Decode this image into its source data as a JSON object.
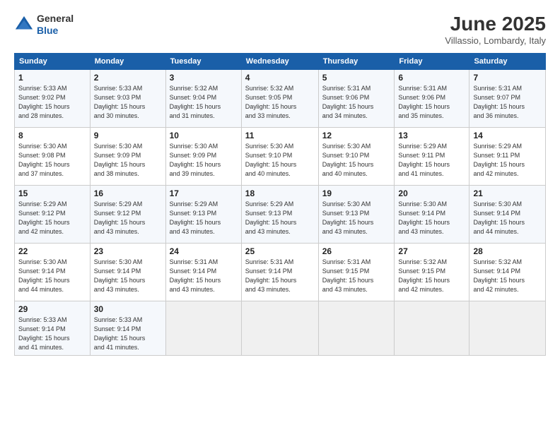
{
  "header": {
    "logo_general": "General",
    "logo_blue": "Blue",
    "title": "June 2025",
    "location": "Villassio, Lombardy, Italy"
  },
  "weekdays": [
    "Sunday",
    "Monday",
    "Tuesday",
    "Wednesday",
    "Thursday",
    "Friday",
    "Saturday"
  ],
  "weeks": [
    [
      {
        "day": "1",
        "info": "Sunrise: 5:33 AM\nSunset: 9:02 PM\nDaylight: 15 hours\nand 28 minutes."
      },
      {
        "day": "2",
        "info": "Sunrise: 5:33 AM\nSunset: 9:03 PM\nDaylight: 15 hours\nand 30 minutes."
      },
      {
        "day": "3",
        "info": "Sunrise: 5:32 AM\nSunset: 9:04 PM\nDaylight: 15 hours\nand 31 minutes."
      },
      {
        "day": "4",
        "info": "Sunrise: 5:32 AM\nSunset: 9:05 PM\nDaylight: 15 hours\nand 33 minutes."
      },
      {
        "day": "5",
        "info": "Sunrise: 5:31 AM\nSunset: 9:06 PM\nDaylight: 15 hours\nand 34 minutes."
      },
      {
        "day": "6",
        "info": "Sunrise: 5:31 AM\nSunset: 9:06 PM\nDaylight: 15 hours\nand 35 minutes."
      },
      {
        "day": "7",
        "info": "Sunrise: 5:31 AM\nSunset: 9:07 PM\nDaylight: 15 hours\nand 36 minutes."
      }
    ],
    [
      {
        "day": "8",
        "info": "Sunrise: 5:30 AM\nSunset: 9:08 PM\nDaylight: 15 hours\nand 37 minutes."
      },
      {
        "day": "9",
        "info": "Sunrise: 5:30 AM\nSunset: 9:09 PM\nDaylight: 15 hours\nand 38 minutes."
      },
      {
        "day": "10",
        "info": "Sunrise: 5:30 AM\nSunset: 9:09 PM\nDaylight: 15 hours\nand 39 minutes."
      },
      {
        "day": "11",
        "info": "Sunrise: 5:30 AM\nSunset: 9:10 PM\nDaylight: 15 hours\nand 40 minutes."
      },
      {
        "day": "12",
        "info": "Sunrise: 5:30 AM\nSunset: 9:10 PM\nDaylight: 15 hours\nand 40 minutes."
      },
      {
        "day": "13",
        "info": "Sunrise: 5:29 AM\nSunset: 9:11 PM\nDaylight: 15 hours\nand 41 minutes."
      },
      {
        "day": "14",
        "info": "Sunrise: 5:29 AM\nSunset: 9:11 PM\nDaylight: 15 hours\nand 42 minutes."
      }
    ],
    [
      {
        "day": "15",
        "info": "Sunrise: 5:29 AM\nSunset: 9:12 PM\nDaylight: 15 hours\nand 42 minutes."
      },
      {
        "day": "16",
        "info": "Sunrise: 5:29 AM\nSunset: 9:12 PM\nDaylight: 15 hours\nand 43 minutes."
      },
      {
        "day": "17",
        "info": "Sunrise: 5:29 AM\nSunset: 9:13 PM\nDaylight: 15 hours\nand 43 minutes."
      },
      {
        "day": "18",
        "info": "Sunrise: 5:29 AM\nSunset: 9:13 PM\nDaylight: 15 hours\nand 43 minutes."
      },
      {
        "day": "19",
        "info": "Sunrise: 5:30 AM\nSunset: 9:13 PM\nDaylight: 15 hours\nand 43 minutes."
      },
      {
        "day": "20",
        "info": "Sunrise: 5:30 AM\nSunset: 9:14 PM\nDaylight: 15 hours\nand 43 minutes."
      },
      {
        "day": "21",
        "info": "Sunrise: 5:30 AM\nSunset: 9:14 PM\nDaylight: 15 hours\nand 44 minutes."
      }
    ],
    [
      {
        "day": "22",
        "info": "Sunrise: 5:30 AM\nSunset: 9:14 PM\nDaylight: 15 hours\nand 44 minutes."
      },
      {
        "day": "23",
        "info": "Sunrise: 5:30 AM\nSunset: 9:14 PM\nDaylight: 15 hours\nand 43 minutes."
      },
      {
        "day": "24",
        "info": "Sunrise: 5:31 AM\nSunset: 9:14 PM\nDaylight: 15 hours\nand 43 minutes."
      },
      {
        "day": "25",
        "info": "Sunrise: 5:31 AM\nSunset: 9:14 PM\nDaylight: 15 hours\nand 43 minutes."
      },
      {
        "day": "26",
        "info": "Sunrise: 5:31 AM\nSunset: 9:15 PM\nDaylight: 15 hours\nand 43 minutes."
      },
      {
        "day": "27",
        "info": "Sunrise: 5:32 AM\nSunset: 9:15 PM\nDaylight: 15 hours\nand 42 minutes."
      },
      {
        "day": "28",
        "info": "Sunrise: 5:32 AM\nSunset: 9:14 PM\nDaylight: 15 hours\nand 42 minutes."
      }
    ],
    [
      {
        "day": "29",
        "info": "Sunrise: 5:33 AM\nSunset: 9:14 PM\nDaylight: 15 hours\nand 41 minutes."
      },
      {
        "day": "30",
        "info": "Sunrise: 5:33 AM\nSunset: 9:14 PM\nDaylight: 15 hours\nand 41 minutes."
      },
      {
        "day": "",
        "info": ""
      },
      {
        "day": "",
        "info": ""
      },
      {
        "day": "",
        "info": ""
      },
      {
        "day": "",
        "info": ""
      },
      {
        "day": "",
        "info": ""
      }
    ]
  ]
}
